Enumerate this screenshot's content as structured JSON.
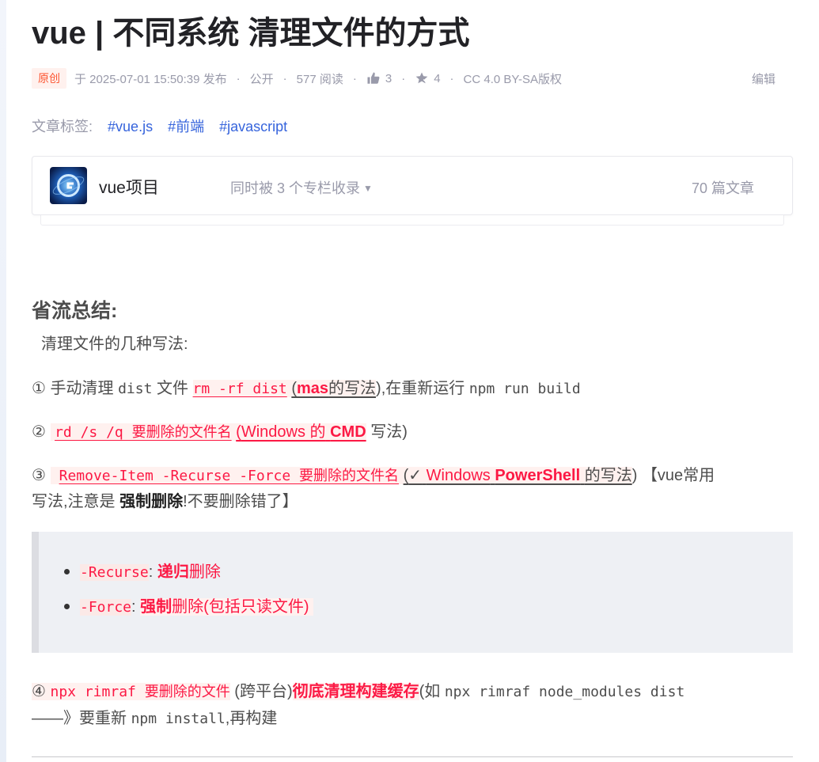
{
  "article": {
    "title": "vue | 不同系统 清理文件的方式"
  },
  "meta": {
    "badge": "原创",
    "published": "于 2025-07-01 15:50:39 发布",
    "visibility": "公开",
    "reads": "577 阅读",
    "likes": "3",
    "favorites": "4",
    "license": "CC 4.0 BY-SA版权",
    "edit": "编辑",
    "sep": "·"
  },
  "tags": {
    "label": "文章标签:",
    "items": [
      "#vue.js",
      "#前端",
      "#javascript"
    ]
  },
  "column": {
    "name": "vue项目",
    "multi": "同时被 3 个专栏收录",
    "count": "70 篇文章",
    "avatar_icon": "column-logo-icon"
  },
  "content": {
    "heading": "省流总结:",
    "intro": "清理文件的几种写法:",
    "item1": {
      "num": "①",
      "pre": "手动清理",
      "dist": "dist",
      "file": "文件",
      "cmd": "rm -rf dist",
      "paren_open": "(",
      "mas": "mas",
      "mas_rest": "的写法",
      "paren_close": ")",
      "mid": ",在重新运行",
      "npm": "npm run build"
    },
    "item2": {
      "num": "②",
      "cmd": "rd /s /q 要删除的文件名",
      "paren_open": "(",
      "win": "Windows 的",
      "cmdtag": "CMD",
      "rest": "写法)"
    },
    "item3": {
      "num": "③",
      "cmd": "Remove-Item -Recurse -Force 要删除的文件名",
      "paren_open": "(",
      "check": "✓",
      "win": "Windows",
      "ps": "PowerShell",
      "ps_rest": "的写法",
      "paren_close": ")",
      "tail": "【vue常用",
      "line2_a": "写法,注意是",
      "line2_b": "强制删除",
      "line2_c": "!不要删除错了】"
    },
    "quote": {
      "li1_code": "-Recurse",
      "li1_colon": ":",
      "li1_bold": "递归",
      "li1_rest": "删除",
      "li2_code": "-Force",
      "li2_colon": ":",
      "li2_bold": "强制",
      "li2_rest": "删除(包括只读文件)"
    },
    "item4": {
      "num": "④",
      "cmd": "npx rimraf 要删除的文件",
      "paren": "(跨平台)",
      "bold": "彻底清理构建缓存",
      "ru": "(如",
      "example": "npx rimraf node_modules dist",
      "line2_a": "——》要重新",
      "npm": "npm install",
      "line2_b": ",再构建"
    }
  }
}
